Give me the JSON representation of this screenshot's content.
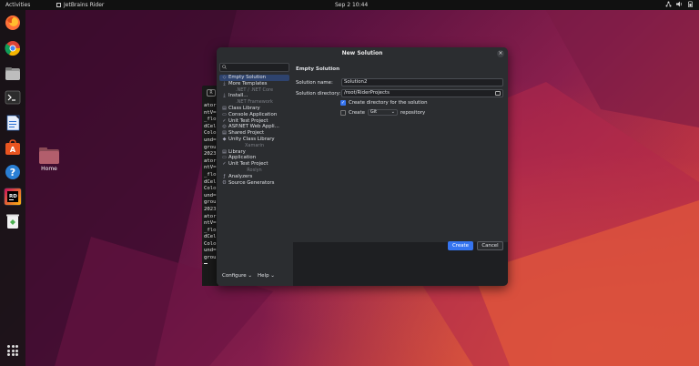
{
  "topbar": {
    "activities": "Activities",
    "app_name": "JetBrains Rider",
    "clock": "Sep 2  10:44"
  },
  "dock": {
    "items": [
      {
        "icon": "firefox-icon"
      },
      {
        "icon": "chrome-icon"
      },
      {
        "icon": "files-icon"
      },
      {
        "icon": "terminal-icon"
      },
      {
        "icon": "writer-icon"
      },
      {
        "icon": "software-icon"
      },
      {
        "icon": "help-icon"
      },
      {
        "icon": "rider-icon",
        "label": "RD"
      },
      {
        "icon": "trash-icon"
      }
    ]
  },
  "desktop": {
    "home_label": "Home"
  },
  "terminal": {
    "tab_label": "R",
    "lines": [
      "ator",
      "ntV=",
      "_flo",
      "dCel",
      "Colo",
      "und=",
      "grou",
      "2023",
      "ator",
      "ntV=",
      "_flo",
      "dCel",
      "Colo",
      "und=",
      "grou",
      "2023",
      "ator",
      "ntV=",
      "_flo",
      "dCel",
      "Colo",
      "und=",
      "grou"
    ]
  },
  "dialog": {
    "title": "New Solution",
    "close": "×",
    "search_placeholder": "",
    "templates": [
      {
        "type": "item",
        "label": "Empty Solution",
        "selected": true
      },
      {
        "type": "item",
        "label": "More Templates"
      },
      {
        "type": "group",
        "label": ".NET / .NET Core"
      },
      {
        "type": "item",
        "label": "Install..."
      },
      {
        "type": "group",
        "label": ".NET Framework"
      },
      {
        "type": "item",
        "label": "Class Library"
      },
      {
        "type": "item",
        "label": "Console Application"
      },
      {
        "type": "item",
        "label": "Unit Test Project"
      },
      {
        "type": "item",
        "label": "ASP.NET Web Appli..."
      },
      {
        "type": "item",
        "label": "Shared Project"
      },
      {
        "type": "item",
        "label": "Unity Class Library"
      },
      {
        "type": "group",
        "label": "Xamarin"
      },
      {
        "type": "item",
        "label": "Library"
      },
      {
        "type": "item",
        "label": "Application"
      },
      {
        "type": "item",
        "label": "Unit Test Project"
      },
      {
        "type": "group",
        "label": "Roslyn"
      },
      {
        "type": "item",
        "label": "Analyzers"
      },
      {
        "type": "item",
        "label": "Source Generators"
      }
    ],
    "footer": {
      "configure": "Configure ⌄",
      "help": "Help ⌄"
    },
    "form": {
      "heading": "Empty Solution",
      "solution_name_label": "Solution name:",
      "solution_name_value": "Solution2",
      "solution_dir_label": "Solution directory:",
      "solution_dir_value": "/root/RiderProjects",
      "create_dir_label": "Create directory for the solution",
      "create_dir_checked": true,
      "create_repo_prefix": "Create",
      "repo_type": "Git",
      "repo_suffix": "repository",
      "create_repo_checked": false
    },
    "buttons": {
      "create": "Create",
      "cancel": "Cancel"
    }
  },
  "colors": {
    "accent": "#3574f0",
    "selection": "#2e436e",
    "dialog_bg": "#2b2d30"
  }
}
